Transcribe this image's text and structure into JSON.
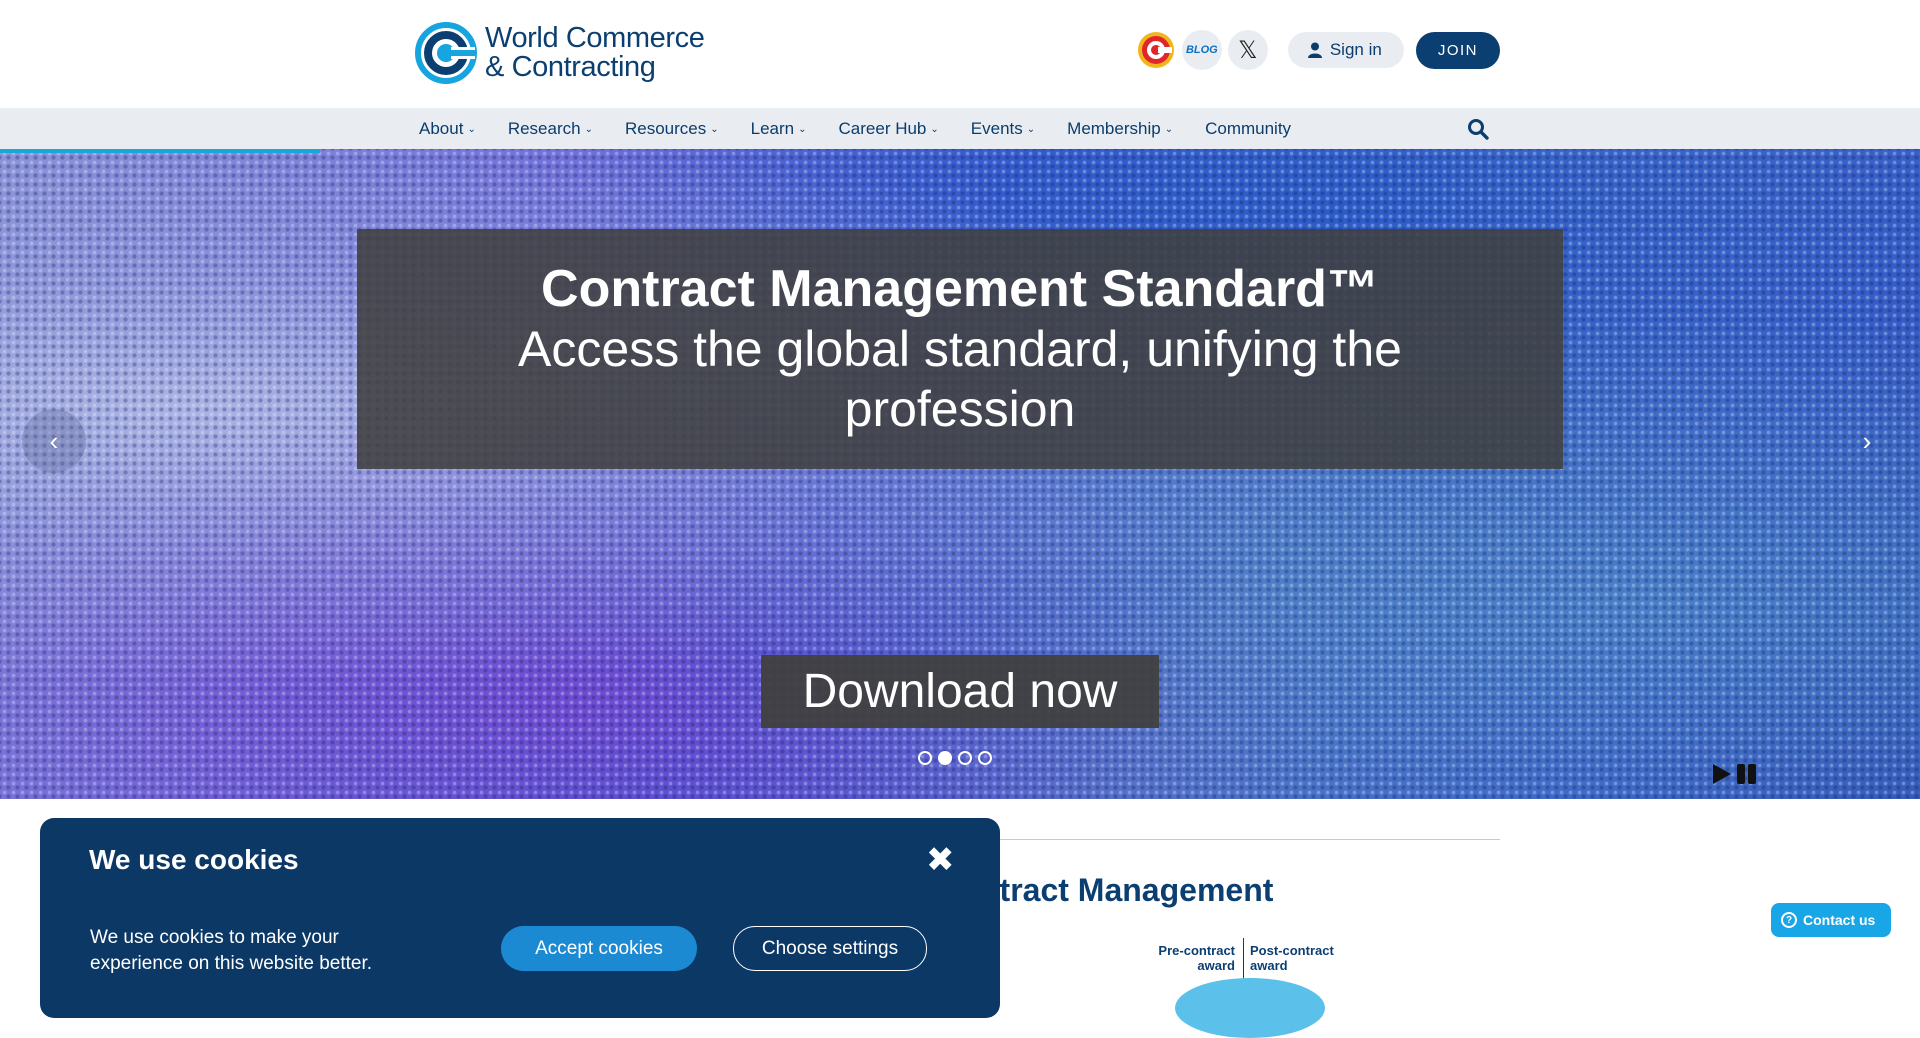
{
  "header": {
    "logo_line1": "World Commerce",
    "logo_line2": "& Contracting",
    "icons": [
      "brand-logo-icon",
      "blog-icon",
      "x-twitter-icon",
      "user-icon"
    ],
    "blog_label": "BLOG",
    "x_label": "𝕏",
    "signin_label": "Sign in",
    "join_label": "JOIN"
  },
  "nav": {
    "items": [
      {
        "label": "About",
        "has_dropdown": true
      },
      {
        "label": "Research",
        "has_dropdown": true
      },
      {
        "label": "Resources",
        "has_dropdown": true
      },
      {
        "label": "Learn",
        "has_dropdown": true
      },
      {
        "label": "Career Hub",
        "has_dropdown": true
      },
      {
        "label": "Events",
        "has_dropdown": true
      },
      {
        "label": "Membership",
        "has_dropdown": true
      },
      {
        "label": "Community",
        "has_dropdown": false
      }
    ],
    "chevron": "⌄"
  },
  "hero": {
    "title": "Contract Management Standard™",
    "subtitle": "Access the global standard, unifying the profession",
    "cta_label": "Download now",
    "prev_arrow": "‹",
    "next_arrow": "›",
    "slide_count": 4,
    "active_slide": 2
  },
  "section": {
    "title": "ntract Management",
    "diagram_pre_line1": "Pre-contract",
    "diagram_pre_line2": "award",
    "diagram_post_line1": "Post-contract",
    "diagram_post_line2": "award"
  },
  "contact": {
    "label": "Contact us",
    "icon_glyph": "?"
  },
  "cookie": {
    "title": "We use cookies",
    "close_glyph": "✖",
    "text": "We use cookies to make your experience on this website better.",
    "accept_label": "Accept cookies",
    "settings_label": "Choose settings"
  },
  "colors": {
    "brand_navy": "#0c3f71",
    "accent_cyan": "#19a6d8",
    "cookie_bg": "#0c3866",
    "accept_bg": "#1b8ad3",
    "nav_bg": "#e9edf1"
  }
}
